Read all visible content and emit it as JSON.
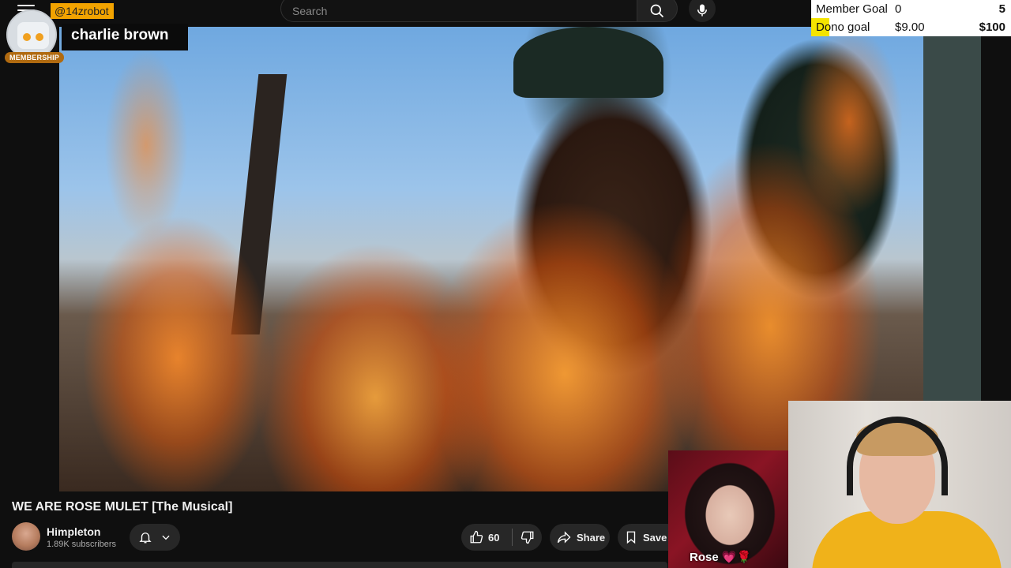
{
  "header": {
    "search_placeholder": "Search"
  },
  "goals": [
    {
      "label": "Member Goal",
      "current": "0",
      "target": "5",
      "progress": 0.0
    },
    {
      "label": "Dono goal",
      "current": "$9.00",
      "target": "$100",
      "progress": 0.09
    }
  ],
  "chat_overlay": {
    "username": "@14zrobot",
    "badge": "MEMBERSHIP",
    "message": "charlie brown"
  },
  "video": {
    "title": "WE ARE ROSE MULET [The Musical]",
    "channel_name": "Himpleton",
    "subscribers": "1.89K subscribers",
    "likes": "60",
    "share_label": "Share",
    "save_label": "Save"
  },
  "webcams": {
    "guest_label": "Rose 💗🌹"
  },
  "colors": {
    "goal_fill": "#f4e400",
    "member_badge": "#b06a10",
    "chat_user_bg": "#f2a300"
  }
}
